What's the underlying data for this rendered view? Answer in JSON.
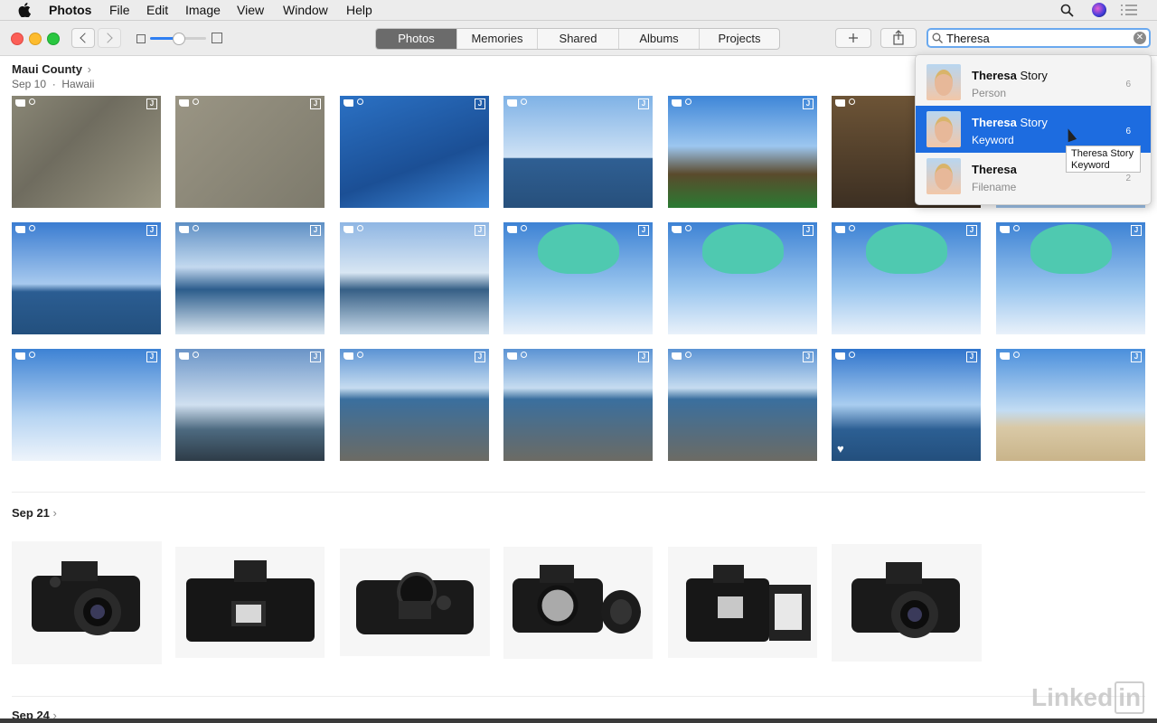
{
  "menubar": {
    "app_name": "Photos",
    "items": [
      "File",
      "Edit",
      "Image",
      "View",
      "Window",
      "Help"
    ],
    "right_icons": [
      "search-icon",
      "siri-icon",
      "list-icon"
    ]
  },
  "toolbar": {
    "tabs": [
      {
        "label": "Photos",
        "active": true
      },
      {
        "label": "Memories",
        "active": false
      },
      {
        "label": "Shared",
        "active": false
      },
      {
        "label": "Albums",
        "active": false
      },
      {
        "label": "Projects",
        "active": false
      }
    ],
    "add_icon": "plus-icon",
    "share_icon": "share-icon",
    "search_value": "Theresa",
    "accent": "#1d6ce0"
  },
  "moment1": {
    "title": "Maui County",
    "date": "Sep 10",
    "location": "Hawaii"
  },
  "moment2": {
    "title": "Sep 21"
  },
  "moment3": {
    "title": "Sep 24"
  },
  "suggestions": [
    {
      "match": "Theresa",
      "rest": " Story",
      "type": "Person",
      "count": "6"
    },
    {
      "match": "Theresa",
      "rest": " Story",
      "type": "Keyword",
      "count": "6"
    },
    {
      "match": "Theresa",
      "rest": "",
      "type": "Filename",
      "count": "2"
    }
  ],
  "tooltip": {
    "line1": "Theresa Story",
    "line2": "Keyword"
  },
  "watermark": {
    "text": "Linked",
    "in": "in"
  }
}
